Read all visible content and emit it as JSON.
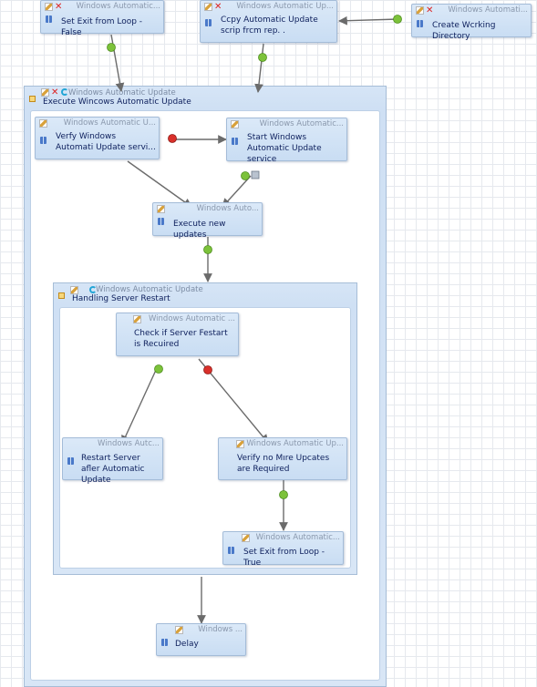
{
  "outer_container": {
    "header": "Windows Automatic Update",
    "label": "Execute Wincows Automatic Update"
  },
  "restart_container": {
    "header": "Windows Automatic Update",
    "label": "Handling Server Restart"
  },
  "nodes": {
    "set_exit_false": {
      "header": "Windows Automatic...",
      "label": "Set Exit from Loop - False"
    },
    "copy_script": {
      "header": "Windows Automatic Up...",
      "label": "Ccpy Automatic Update scrip frcm rep. ."
    },
    "create_dir": {
      "header": "Windows Automati...",
      "label": "Create Wcrking Directory"
    },
    "verify_service": {
      "header": "Windows Automatic U...",
      "label": "Verfy Windows Automati Update servi..."
    },
    "start_service": {
      "header": "Windows Automatic...",
      "label": "Start Windows Automatic Update service"
    },
    "execute_updates": {
      "header": "Windows Auto...",
      "label": "Execute new updates"
    },
    "check_restart": {
      "header": "Windows Automatic ...",
      "label": "Check if Server Festart is Recuired"
    },
    "restart_server": {
      "header": "Windows Autc...",
      "label": "Restart Server afler Automatic Update"
    },
    "verify_no_updates": {
      "header": "Windows Automatic Up...",
      "label": "Verify no Mıre Upcates are Required"
    },
    "set_exit_true": {
      "header": "Windows Automatic...",
      "label": "Set Exit from Loop - True"
    },
    "delay": {
      "header": "Windows ...",
      "label": "Delay"
    }
  },
  "colors": {
    "success_connector": "#7cc23a",
    "failure_connector": "#d9302a",
    "edge": "#6b6b6b",
    "node_fill": "#d3e3f6",
    "label_text": "#0d1f5c",
    "header_text": "#8a98ad"
  },
  "icons": {
    "node_side": "activity-bars-icon",
    "node_header": "edit-pencil-icon",
    "delete": "delete-x-icon",
    "refresh": "refresh-icon",
    "collapse": "collapse-box-icon"
  }
}
